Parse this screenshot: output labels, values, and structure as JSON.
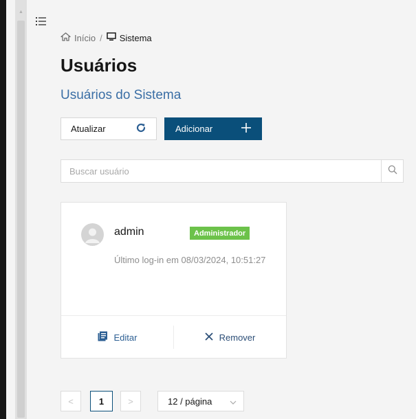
{
  "breadcrumb": {
    "home": "Início",
    "separator": "/",
    "current": "Sistema"
  },
  "page": {
    "title": "Usuários",
    "subtitle": "Usuários do Sistema"
  },
  "toolbar": {
    "refresh_label": "Atualizar",
    "add_label": "Adicionar"
  },
  "search": {
    "placeholder": "Buscar usuário",
    "value": ""
  },
  "users": [
    {
      "name": "admin",
      "role": "Administrador",
      "last_login": "Último log-in em 08/03/2024, 10:51:27",
      "edit_label": "Editar",
      "remove_label": "Remover"
    }
  ],
  "pagination": {
    "prev": "<",
    "current_page": "1",
    "next": ">",
    "page_size": "12 / página"
  },
  "colors": {
    "primary": "#0a4f7a",
    "subtitle": "#3a6ea5",
    "badge": "#6cc24a",
    "background": "#f4f4f4",
    "sidebar": "#161616"
  },
  "icons": {
    "menu": "list-icon",
    "home": "home-icon",
    "system": "monitor-icon",
    "refresh": "refresh-icon",
    "add": "plus-icon",
    "search": "search-icon",
    "avatar": "user-avatar-icon",
    "edit": "edit-icon",
    "remove": "close-icon",
    "page_size": "chevron-down-icon"
  }
}
